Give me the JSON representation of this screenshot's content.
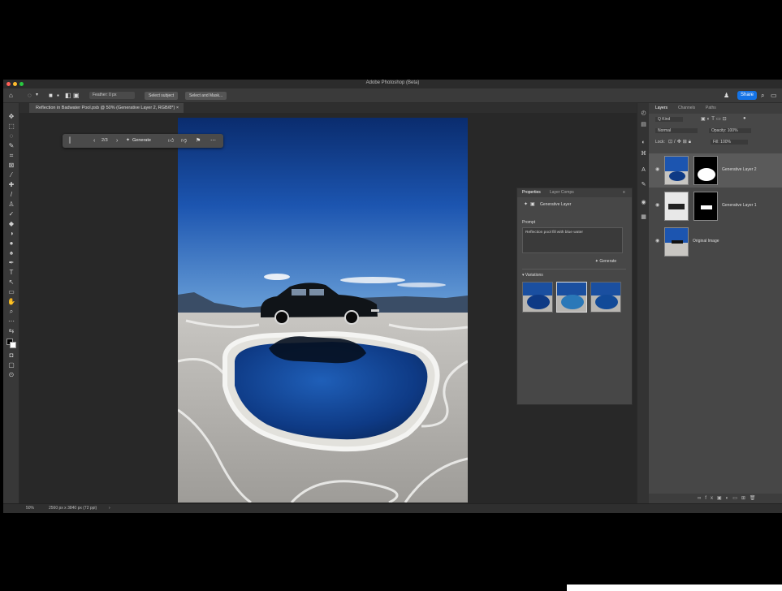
{
  "window": {
    "title": "Adobe Photoshop (Beta)"
  },
  "options_bar": {
    "feather": "Feather: 0 px",
    "select_subject": "Select subject",
    "select_and_mask": "Select and Mask...",
    "share": "Share"
  },
  "document_tab": {
    "label": "Reflection in Badwater Pool.psb @ 50% (Generative Layer 2, RGB/8*)"
  },
  "contextual_taskbar": {
    "counter": "2/3",
    "generate_label": "Generate"
  },
  "properties": {
    "tab_properties": "Properties",
    "tab_layer_comps": "Layer Comps",
    "layer_type": "Generative Layer",
    "prompt_label": "Prompt",
    "prompt_text": "Reflection pool fill with blue water",
    "generate_button": "Generate",
    "variations_label": "Variations"
  },
  "layers_panel": {
    "tab_layers": "Layers",
    "tab_channels": "Channels",
    "tab_paths": "Paths",
    "kind_label": "Q Kind",
    "blend_mode": "Normal",
    "opacity": "Opacity: 100%",
    "lock_label": "Lock:",
    "fill": "Fill: 100%",
    "layers": [
      {
        "name": "Generative Layer 2"
      },
      {
        "name": "Generative Layer 1"
      },
      {
        "name": "Original Image"
      }
    ]
  },
  "status_bar": {
    "zoom": "50%",
    "doc_info": "2560 px x 3840 px (72 ppi)"
  },
  "colors": {
    "accent": "#1473e6",
    "panel": "#474747",
    "canvas_bg": "#282828"
  }
}
